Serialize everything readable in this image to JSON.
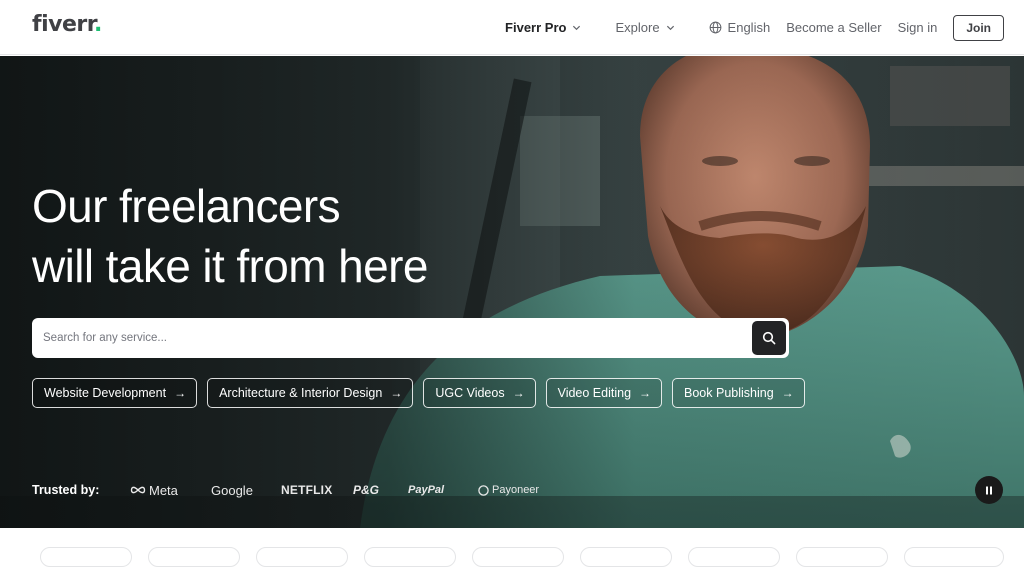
{
  "header": {
    "logo_text": "fiverr",
    "logo_dot": ".",
    "nav": {
      "fiverr_pro": "Fiverr Pro",
      "explore": "Explore",
      "language": "English",
      "become_seller": "Become a Seller",
      "sign_in": "Sign in",
      "join": "Join"
    }
  },
  "hero": {
    "headline_line1": "Our freelancers",
    "headline_line2": "will take it from here",
    "search_placeholder": "Search for any service...",
    "popular_services": [
      "Website Development",
      "Architecture & Interior Design",
      "UGC Videos",
      "Video Editing",
      "Book Publishing"
    ],
    "pill_arrow": "→",
    "trusted_label": "Trusted by:",
    "brands": {
      "meta": "Meta",
      "google": "Google",
      "netflix": "NETFLIX",
      "pg": "P&G",
      "paypal": "PayPal",
      "payoneer": "Payoneer"
    }
  },
  "colors": {
    "brand_green": "#1dbf73",
    "text_dark": "#222325",
    "text_muted": "#62646a",
    "search_button": "#222325"
  },
  "icons": {
    "search": "search-icon",
    "chevron": "chevron-down-icon",
    "globe": "globe-icon",
    "pause": "pause-icon",
    "meta_logo": "meta-infinity-icon",
    "payoneer_logo": "payoneer-circle-icon"
  }
}
